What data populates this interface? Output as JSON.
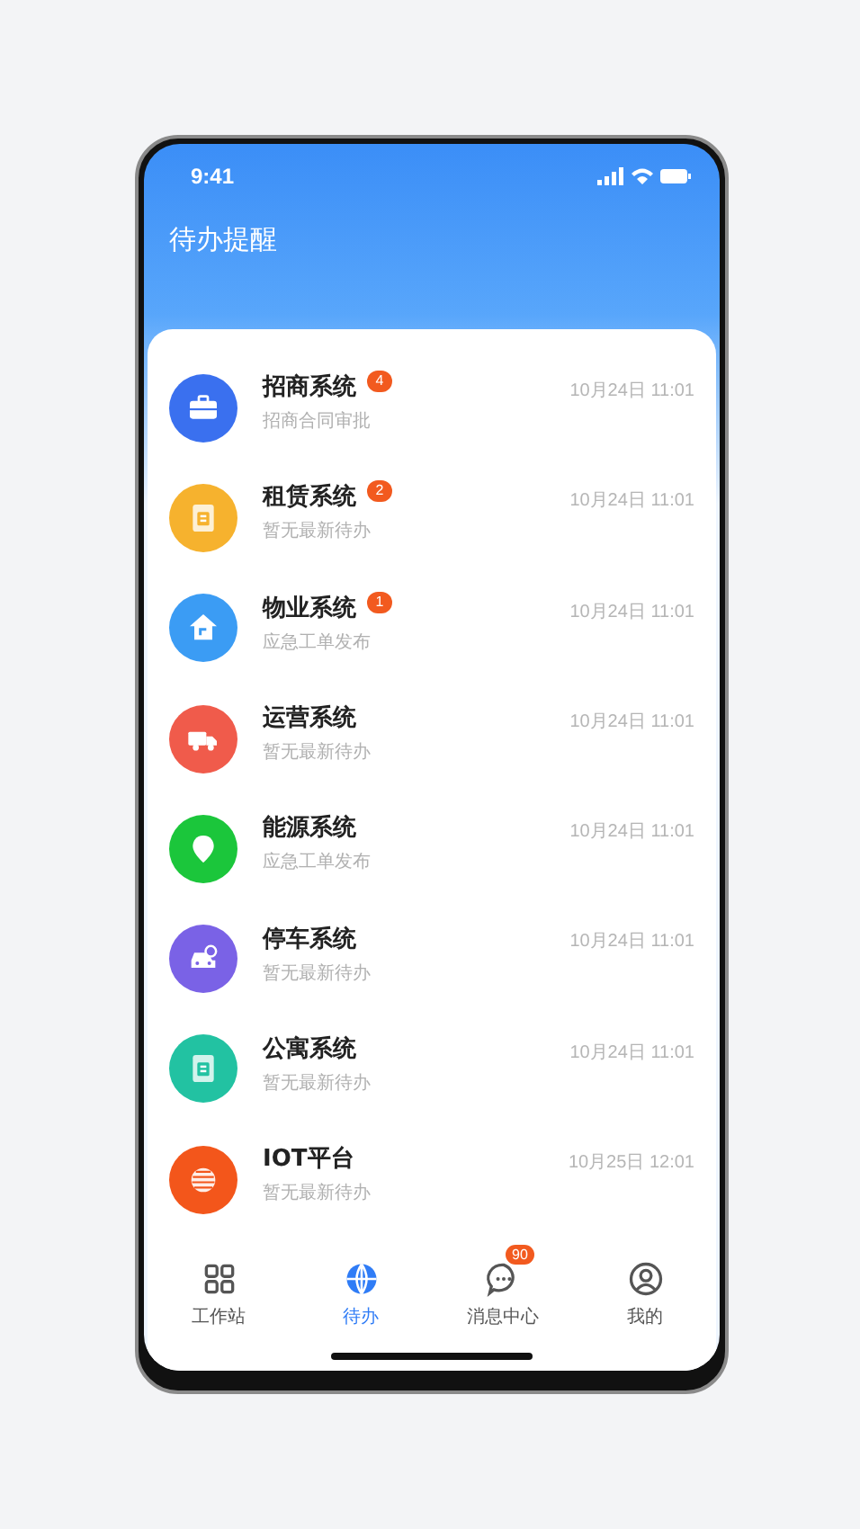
{
  "status_bar": {
    "time": "9:41"
  },
  "title": "待办提醒",
  "items": [
    {
      "kind": "briefcase",
      "color": "#3a70ef",
      "name": "招商系统",
      "badge": "4",
      "subtitle": "招商合同审批",
      "time": "10月24日 11:01"
    },
    {
      "kind": "document",
      "color": "#f6b22e",
      "name": "租赁系统",
      "badge": "2",
      "subtitle": "暂无最新待办",
      "time": "10月24日 11:01"
    },
    {
      "kind": "house",
      "color": "#3b9cf4",
      "name": "物业系统",
      "badge": "1",
      "subtitle": "应急工单发布",
      "time": "10月24日 11:01"
    },
    {
      "kind": "truck",
      "color": "#f05b4b",
      "name": "运营系统",
      "subtitle": "暂无最新待办",
      "time": "10月24日 11:01"
    },
    {
      "kind": "pin",
      "color": "#1bc63b",
      "name": "能源系统",
      "subtitle": "应急工单发布",
      "time": "10月24日 11:01"
    },
    {
      "kind": "car",
      "color": "#7a62e6",
      "name": "停车系统",
      "subtitle": "暂无最新待办",
      "time": "10月24日 11:01"
    },
    {
      "kind": "document",
      "color": "#22c2a2",
      "name": "公寓系统",
      "subtitle": "暂无最新待办",
      "time": "10月24日 11:01"
    },
    {
      "kind": "sphere",
      "color": "#f3561b",
      "name": "IOT平台",
      "subtitle": "暂无最新待办",
      "time": "10月25日 12:01"
    }
  ],
  "tabs": [
    {
      "kind": "grid",
      "label": "工作站",
      "selected": false
    },
    {
      "kind": "globe",
      "label": "待办",
      "selected": true
    },
    {
      "kind": "chat",
      "label": "消息中心",
      "selected": false,
      "badge": "90"
    },
    {
      "kind": "user",
      "label": "我的",
      "selected": false
    }
  ]
}
